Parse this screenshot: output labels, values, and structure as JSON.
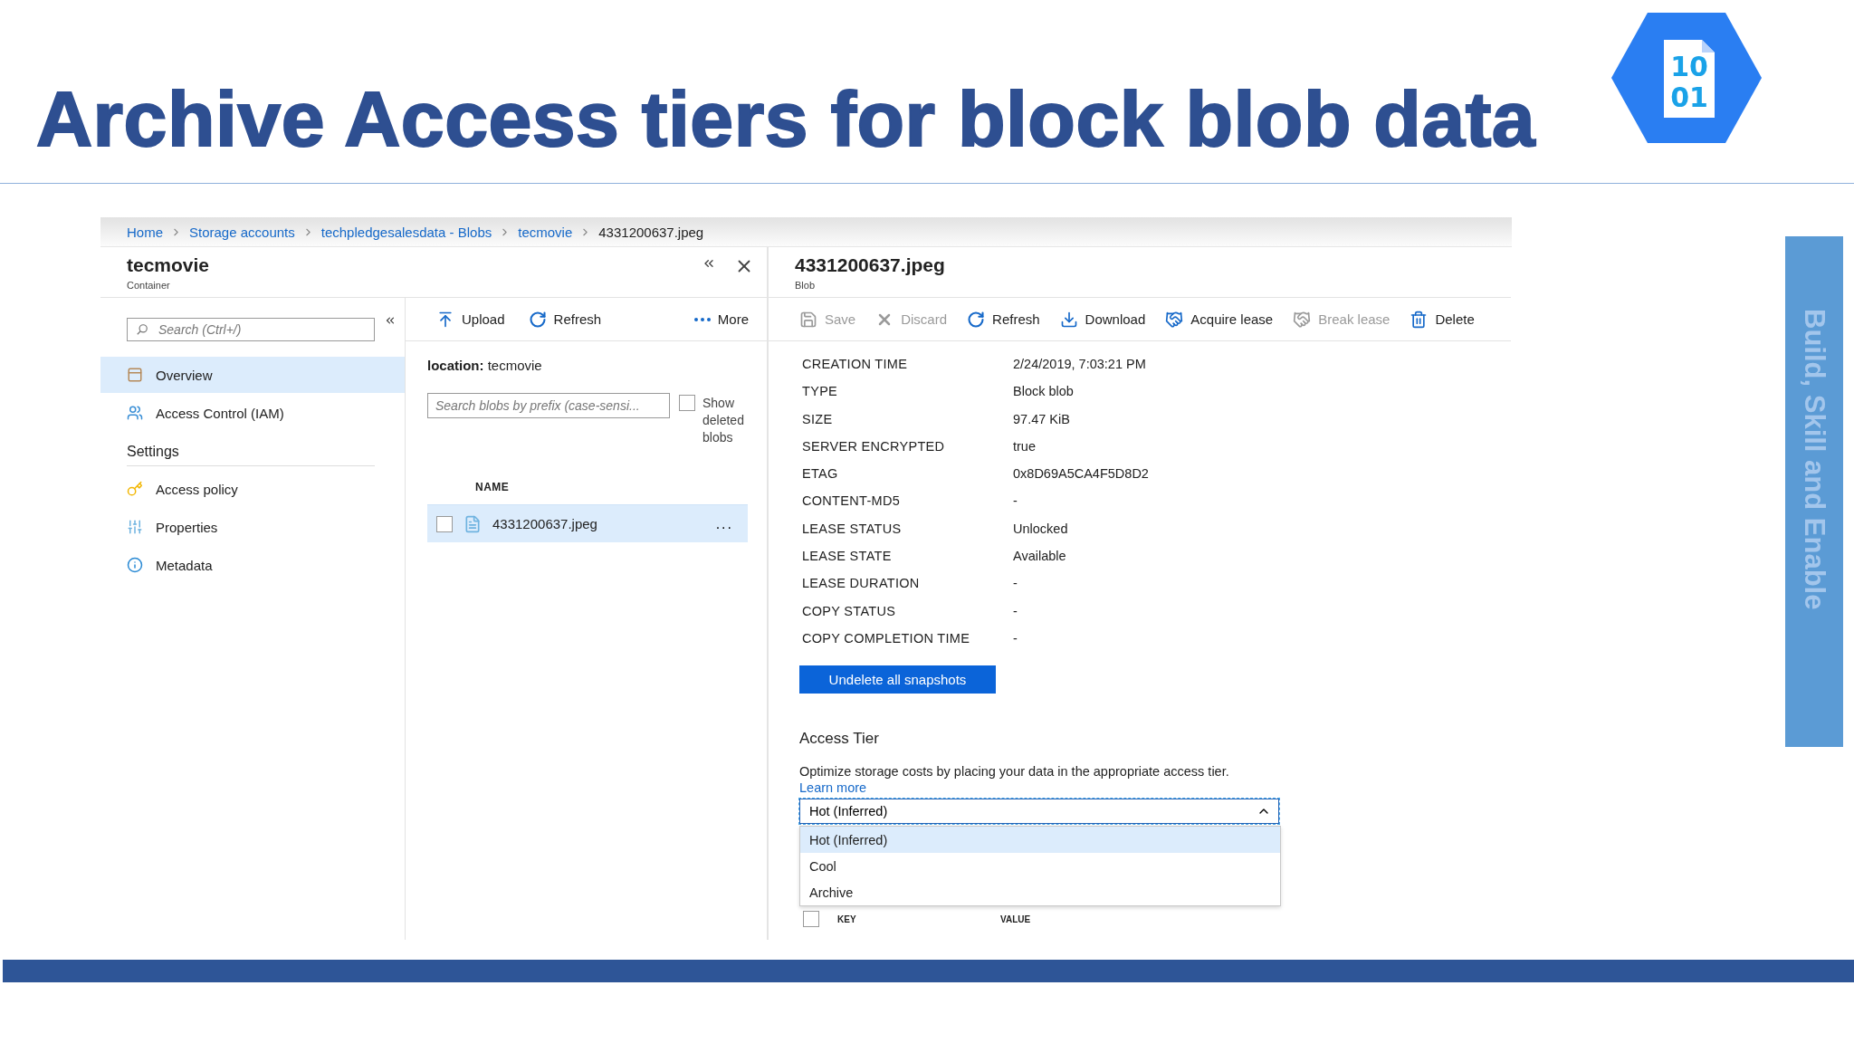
{
  "slide": {
    "title": "Archive Access tiers for block blob data",
    "side_label": "Build, Skill and Enable"
  },
  "logo": {
    "lines": [
      "10",
      "01"
    ]
  },
  "breadcrumb": [
    {
      "label": "Home",
      "current": false
    },
    {
      "label": "Storage accounts",
      "current": false
    },
    {
      "label": "techpledgesalesdata - Blobs",
      "current": false
    },
    {
      "label": "tecmovie",
      "current": false
    },
    {
      "label": "4331200637.jpeg",
      "current": true
    }
  ],
  "container_blade": {
    "title": "tecmovie",
    "subtitle": "Container",
    "search": {
      "placeholder": "Search (Ctrl+/)"
    },
    "nav": [
      {
        "label": "Overview",
        "selected": true
      },
      {
        "label": "Access Control (IAM)",
        "selected": false
      }
    ],
    "settings_heading": "Settings",
    "settings": [
      {
        "label": "Access policy",
        "selected": false
      },
      {
        "label": "Properties",
        "selected": false
      },
      {
        "label": "Metadata",
        "selected": false
      }
    ],
    "toolbar": [
      "Upload",
      "Refresh",
      "More"
    ],
    "location_label": "location:",
    "location": "tecmovie",
    "blob_search": {
      "placeholder": "Search blobs by prefix (case-sensi..."
    },
    "show_deleted": {
      "label": "Show deleted blobs",
      "checked": false
    },
    "columns": [
      "NAME"
    ],
    "rows": [
      {
        "name": "4331200637.jpeg",
        "selected": true,
        "checked": false,
        "menu": "..."
      }
    ]
  },
  "blob_blade": {
    "title": "4331200637.jpeg",
    "subtitle": "Blob",
    "toolbar": [
      {
        "label": "Save",
        "disabled": true
      },
      {
        "label": "Discard",
        "disabled": true
      },
      {
        "label": "Refresh",
        "disabled": false
      },
      {
        "label": "Download",
        "disabled": false
      },
      {
        "label": "Acquire lease",
        "disabled": false
      },
      {
        "label": "Break lease",
        "disabled": true
      },
      {
        "label": "Delete",
        "disabled": false
      }
    ],
    "properties": [
      {
        "label": "CREATION TIME",
        "value": "2/24/2019, 7:03:21 PM"
      },
      {
        "label": "TYPE",
        "value": "Block blob"
      },
      {
        "label": "SIZE",
        "value": "97.47 KiB"
      },
      {
        "label": "SERVER ENCRYPTED",
        "value": "true"
      },
      {
        "label": "ETAG",
        "value": "0x8D69A5CA4F5D8D2"
      },
      {
        "label": "CONTENT-MD5",
        "value": "-"
      },
      {
        "label": "LEASE STATUS",
        "value": "Unlocked"
      },
      {
        "label": "LEASE STATE",
        "value": "Available"
      },
      {
        "label": "LEASE DURATION",
        "value": "-"
      },
      {
        "label": "COPY STATUS",
        "value": "-"
      },
      {
        "label": "COPY COMPLETION TIME",
        "value": "-"
      }
    ],
    "undelete_button": "Undelete all snapshots",
    "access_tier": {
      "heading": "Access Tier",
      "description": "Optimize storage costs by placing your data in the appropriate access tier.",
      "link": "Learn more",
      "value": "Hot (Inferred)",
      "expanded": true,
      "options": [
        {
          "label": "Hot (Inferred)",
          "selected": true
        },
        {
          "label": "Cool",
          "selected": false
        },
        {
          "label": "Archive",
          "selected": false
        }
      ]
    },
    "metadata": {
      "select_all_checked": false,
      "columns": [
        "KEY",
        "VALUE"
      ]
    }
  }
}
